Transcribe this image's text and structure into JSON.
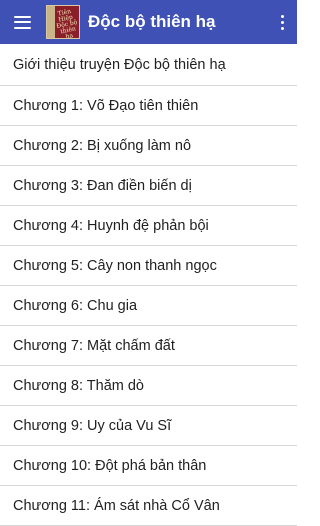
{
  "appbar": {
    "title": "Độc bộ thiên hạ",
    "menu_icon": "hamburger-menu-icon",
    "overflow_icon": "more-vertical-icon",
    "logo_text": "Tiên Hiệp Độc bộ thiên hạ",
    "color": "#3f51b5"
  },
  "chapters": [
    "Giới thiệu truyện Độc bộ thiên hạ",
    "Chương 1: Võ Đạo tiên thiên",
    "Chương 2: Bị xuống làm nô",
    "Chương 3: Đan điền biến dị",
    "Chương 4: Huynh đệ phản bội",
    "Chương 5: Cây non thanh ngọc",
    "Chương 6: Chu gia",
    "Chương 7: Mặt chấm đất",
    "Chương 8: Thăm dò",
    "Chương 9: Uy của Vu Sĩ",
    "Chương 10: Đột phá bản thân",
    "Chương 11: Ám sát nhà Cổ Vân"
  ]
}
